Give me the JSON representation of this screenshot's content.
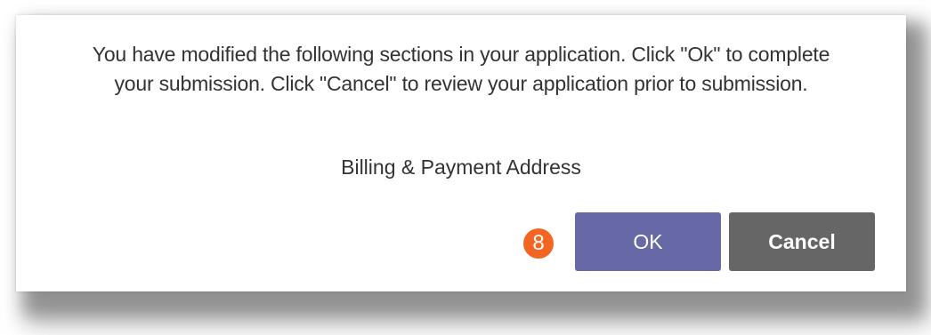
{
  "dialog": {
    "message_lines": [
      "You have modified the following sections in your application. Click \"Ok\" to complete",
      "your submission. Click \"Cancel\" to review your application prior to submission."
    ],
    "modified_sections": [
      "Billing & Payment Address"
    ],
    "step_badge": "8",
    "ok_label": "OK",
    "cancel_label": "Cancel"
  },
  "colors": {
    "ok_button": "#6768a6",
    "cancel_button": "#666666",
    "step_badge": "#f26522",
    "text": "#333333"
  }
}
